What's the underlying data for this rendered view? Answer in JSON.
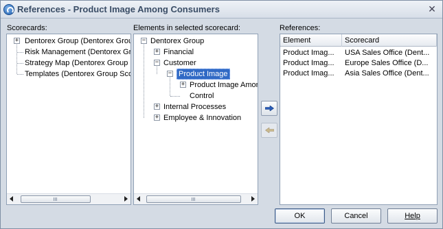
{
  "window": {
    "title": "References - Product Image Among Consumers",
    "close_glyph": "✕"
  },
  "scorecards": {
    "label": "Scorecards:",
    "items": [
      {
        "label": "Dentorex Group (Dentorex Grou",
        "expandable": true
      },
      {
        "label": "Risk Management (Dentorex Gro",
        "expandable": false
      },
      {
        "label": "Strategy Map (Dentorex Group S",
        "expandable": false
      },
      {
        "label": "Templates (Dentorex Group Scor",
        "expandable": false
      }
    ]
  },
  "elements": {
    "label": "Elements in selected scorecard:",
    "tree": [
      {
        "label": "Dentorex Group",
        "state": "expanded"
      },
      {
        "label": "Financial",
        "state": "collapsed"
      },
      {
        "label": "Customer",
        "state": "expanded"
      },
      {
        "label": "Product Image",
        "state": "expanded",
        "selected": true
      },
      {
        "label": "Product Image Amon",
        "state": "collapsed"
      },
      {
        "label": "Control",
        "state": "leaf"
      },
      {
        "label": "Internal Processes",
        "state": "collapsed"
      },
      {
        "label": "Employee & Innovation",
        "state": "collapsed"
      }
    ]
  },
  "transfer": {
    "add_icon": "arrow-right-icon",
    "remove_icon": "arrow-left-icon",
    "remove_enabled": false
  },
  "references": {
    "label": "References:",
    "columns": [
      "Element",
      "Scorecard"
    ],
    "rows": [
      [
        "Product Imag...",
        "USA Sales Office (Dent..."
      ],
      [
        "Product Imag...",
        "Europe Sales Office (D..."
      ],
      [
        "Product Imag...",
        "Asia Sales Office (Dent..."
      ]
    ]
  },
  "buttons": {
    "ok": "OK",
    "cancel": "Cancel",
    "help": "Help"
  }
}
